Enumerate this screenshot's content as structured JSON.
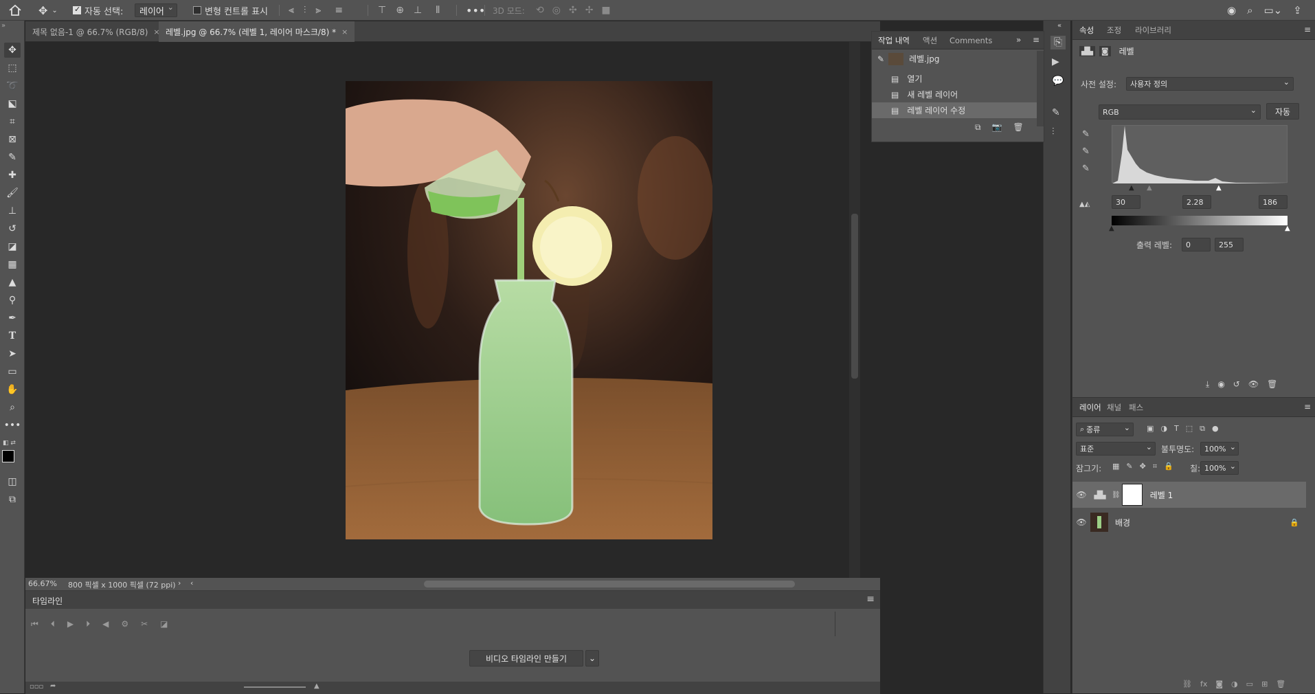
{
  "options_bar": {
    "auto_select_label": "자동 선택:",
    "auto_select_checked": true,
    "layer_select_value": "레이어",
    "transform_controls_label": "변형 컨트롤 표시",
    "mode_3d_label": "3D 모드:"
  },
  "document_tabs": [
    {
      "label": "제목 없음-1 @ 66.7% (RGB/8)"
    },
    {
      "label": "레벨.jpg @ 66.7% (레벨 1, 레이어 마스크/8) *"
    }
  ],
  "status_bar": {
    "zoom": "66.67%",
    "doc_info": "800 픽셀 x 1000 픽셀 (72 ppi)"
  },
  "timeline": {
    "title": "타임라인",
    "create_button": "비디오 타임라인 만들기"
  },
  "history_panel": {
    "tabs": [
      "작업 내역",
      "액션",
      "Comments"
    ],
    "snapshot_name": "레벨.jpg",
    "items": [
      "열기",
      "새 레벨 레이어",
      "레벨 레이어 수정"
    ]
  },
  "properties_panel": {
    "tabs": [
      "속성",
      "조정",
      "라이브러리"
    ],
    "title": "레벨",
    "preset_label": "사전 설정:",
    "preset_value": "사용자 정의",
    "channel_value": "RGB",
    "auto_button": "자동",
    "input_black": "30",
    "input_gamma": "2.28",
    "input_white": "186",
    "output_label": "출력 레벨:",
    "output_black": "0",
    "output_white": "255"
  },
  "layers_panel": {
    "tabs": [
      "레이어",
      "채널",
      "패스"
    ],
    "filter_value": "종류",
    "blend_mode": "표준",
    "opacity_label": "불투명도:",
    "opacity_value": "100%",
    "lock_label": "잠그기:",
    "fill_label": "칠:",
    "fill_value": "100%",
    "layers": [
      {
        "name": "레벨 1",
        "selected": true
      },
      {
        "name": "배경",
        "locked": true
      }
    ]
  },
  "colors": {
    "ui_bg": "#535353",
    "canvas_bg": "#282828",
    "panel_bg": "#535353",
    "accent_selected": "#6a6a6a"
  }
}
